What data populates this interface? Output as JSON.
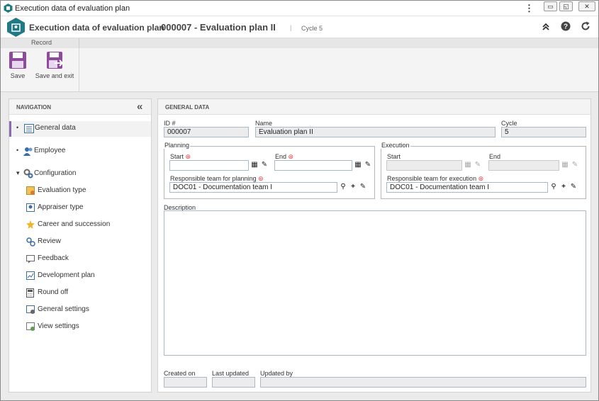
{
  "window": {
    "title": "Execution data of evaluation plan",
    "menu_glyph": "⋮",
    "min": "▭",
    "restore": "◱",
    "close": "✕"
  },
  "header": {
    "breadcrumb_1": "Execution data of evaluation plan",
    "separator": "›",
    "breadcrumb_2": "000007 - Evaluation plan II",
    "divider": "|",
    "cycle": "Cycle 5"
  },
  "toolbar": {
    "group_label": "Record",
    "save_label": "Save",
    "save_exit_label": "Save and exit"
  },
  "navigation": {
    "title": "NAVIGATION",
    "collapse_glyph": "«",
    "items": [
      {
        "label": "General data",
        "icon": "list-icon"
      },
      {
        "label": "Employee",
        "icon": "users-icon"
      },
      {
        "label": "Configuration",
        "icon": "gears-icon"
      }
    ],
    "sub_items": [
      {
        "label": "Evaluation type"
      },
      {
        "label": "Appraiser type"
      },
      {
        "label": "Career and succession"
      },
      {
        "label": "Review"
      },
      {
        "label": "Feedback"
      },
      {
        "label": "Development plan"
      },
      {
        "label": "Round off"
      },
      {
        "label": "General settings"
      },
      {
        "label": "View settings"
      }
    ]
  },
  "general": {
    "title": "GENERAL DATA",
    "id_label": "ID #",
    "id_value": "000007",
    "name_label": "Name",
    "name_value": "Evaluation plan II",
    "cycle_label": "Cycle",
    "cycle_value": "5",
    "planning": {
      "title": "Planning",
      "start_label": "Start",
      "end_label": "End",
      "team_label": "Responsible team for planning",
      "team_value": "DOC01 - Documentation team I"
    },
    "execution": {
      "title": "Execution",
      "start_label": "Start",
      "end_label": "End",
      "team_label": "Responsible team for execution",
      "team_value": "DOC01 - Documentation team I"
    },
    "description_label": "Description",
    "created_label": "Created on",
    "updated_label": "Last updated",
    "updated_by_label": "Updated by"
  },
  "glyphs": {
    "required": "⊛",
    "bullet": "•",
    "caret": "▾",
    "search": "⚲",
    "plus": "+",
    "cal": "▦",
    "clear": "✎"
  },
  "colors": {
    "accent": "#1f7a85",
    "nav_active": "#8a6bb0",
    "toolbar_icon": "#8e4b9c"
  }
}
